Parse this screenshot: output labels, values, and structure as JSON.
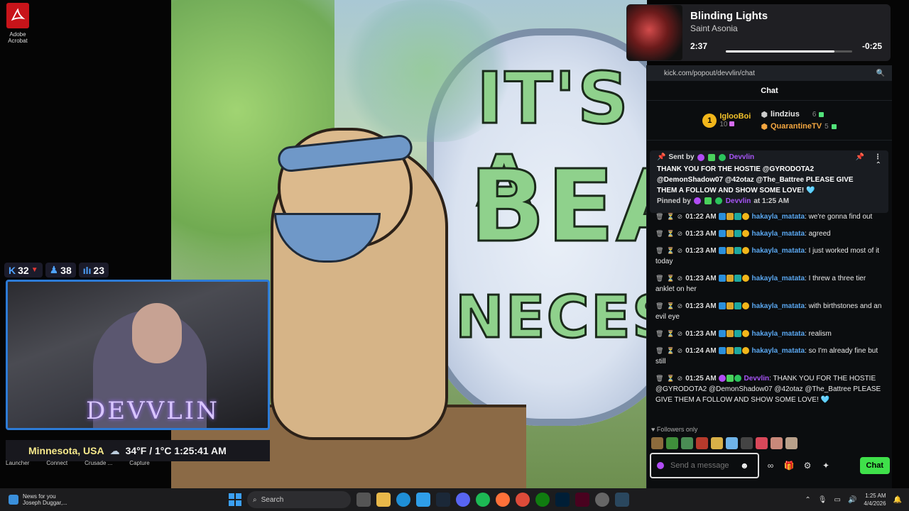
{
  "desktop": {
    "icon_label": "Adobe Acrobat"
  },
  "stream": {
    "art_line1": "IT'S A",
    "art_line2": "BEAR",
    "art_line3": "NECESSI",
    "stats": [
      {
        "icon": "kick-icon",
        "value": "32",
        "arrow": "▼",
        "arrow_color": "#e53935"
      },
      {
        "icon": "person-icon",
        "value": "38"
      },
      {
        "icon": "bar-chart-icon",
        "value": "23"
      }
    ],
    "cam_name": "DEVVLIN",
    "location": "Minnesota, USA",
    "weather": "34°F / 1°C 1:25:41 AM",
    "launcher_items": [
      "Launcher",
      "Connect",
      "Crusade ...",
      "Capture"
    ]
  },
  "now_playing": {
    "title": "Blinding Lights",
    "artist": "Saint Asonia",
    "elapsed": "2:37",
    "remaining": "-0:25",
    "progress": 0.86
  },
  "chat": {
    "url": "kick.com/popout/devvlin/chat",
    "title": "Chat",
    "leaderboard": {
      "first": {
        "rank": "1",
        "name": "IglooBoi",
        "count": "10"
      },
      "second": {
        "name": "lindzius",
        "count": "6"
      },
      "third": {
        "name": "QuarantineTV",
        "count": "5"
      }
    },
    "pinned": {
      "sent_by": "Sent by",
      "sender": "Devvlin",
      "message": "THANK YOU FOR THE HOSTIE @GYRODOTA2 @DemonShadow07 @42otaz @The_Battree PLEASE GIVE THEM A FOLLOW AND SHOW SOME LOVE! 🩵",
      "pinned_by": "Pinned by",
      "pinner": "Devvlin",
      "pinned_at": "at 1:25 AM"
    },
    "messages": [
      {
        "time": "01:22 AM",
        "user": "hakayla_matata",
        "text": ": we're gonna find out"
      },
      {
        "time": "01:23 AM",
        "user": "hakayla_matata",
        "text": ": agreed"
      },
      {
        "time": "01:23 AM",
        "user": "hakayla_matata",
        "text": ": I just worked most of it today"
      },
      {
        "time": "01:23 AM",
        "user": "hakayla_matata",
        "text": ": I threw a three tier anklet on her"
      },
      {
        "time": "01:23 AM",
        "user": "hakayla_matata",
        "text": ": with birthstones and an evil eye"
      },
      {
        "time": "01:23 AM",
        "user": "hakayla_matata",
        "text": ": realism"
      },
      {
        "time": "01:24 AM",
        "user": "hakayla_matata",
        "text": ": so I'm already fine but still"
      },
      {
        "time": "01:25 AM",
        "user": "Devvlin",
        "text": ": THANK YOU FOR THE HOSTIE @GYRODOTA2 @DemonShadow07 @42otaz @The_Battree PLEASE GIVE THEM A FOLLOW AND SHOW SOME LOVE! 🩵"
      }
    ],
    "followers_only": "Followers only",
    "input_placeholder": "Send a message",
    "send_label": "Chat"
  },
  "taskbar": {
    "news_title": "News for you",
    "news_sub": "Joseph Duggar,...",
    "search_placeholder": "Search",
    "time": "1:25 AM",
    "date": "4/4/2026"
  }
}
